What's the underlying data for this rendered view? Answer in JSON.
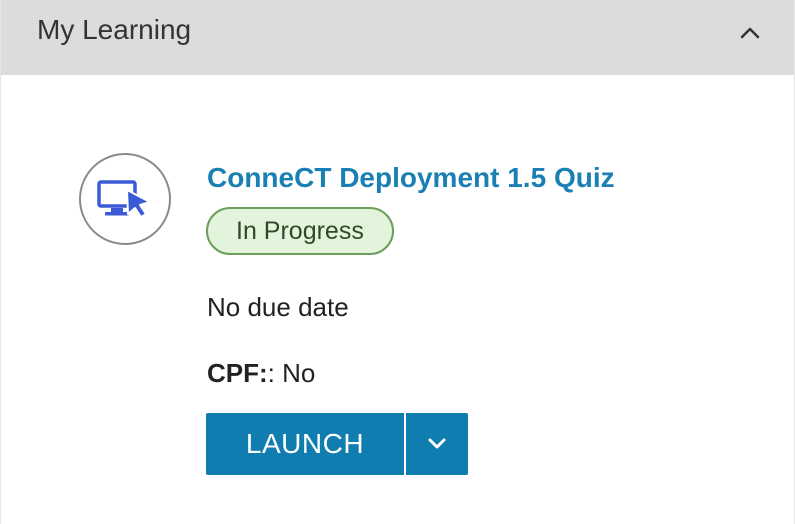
{
  "panel": {
    "title": "My Learning",
    "collapse_icon": "chevron-up-icon"
  },
  "course": {
    "icon": "screen-cursor-icon",
    "title": "ConneCT Deployment 1.5 Quiz",
    "status": "In Progress",
    "due_date": "No due date",
    "cpf_label": "CPF:",
    "cpf_value": ": No",
    "launch_label": "LAUNCH",
    "dropdown_icon": "chevron-down-icon"
  },
  "colors": {
    "header_bg": "#dcdcdc",
    "link_blue": "#1a80b3",
    "button_blue": "#0f7db0",
    "badge_bg": "#e3f4dc",
    "badge_border": "#6b9e5a",
    "icon_blue": "#3b5bd6"
  }
}
